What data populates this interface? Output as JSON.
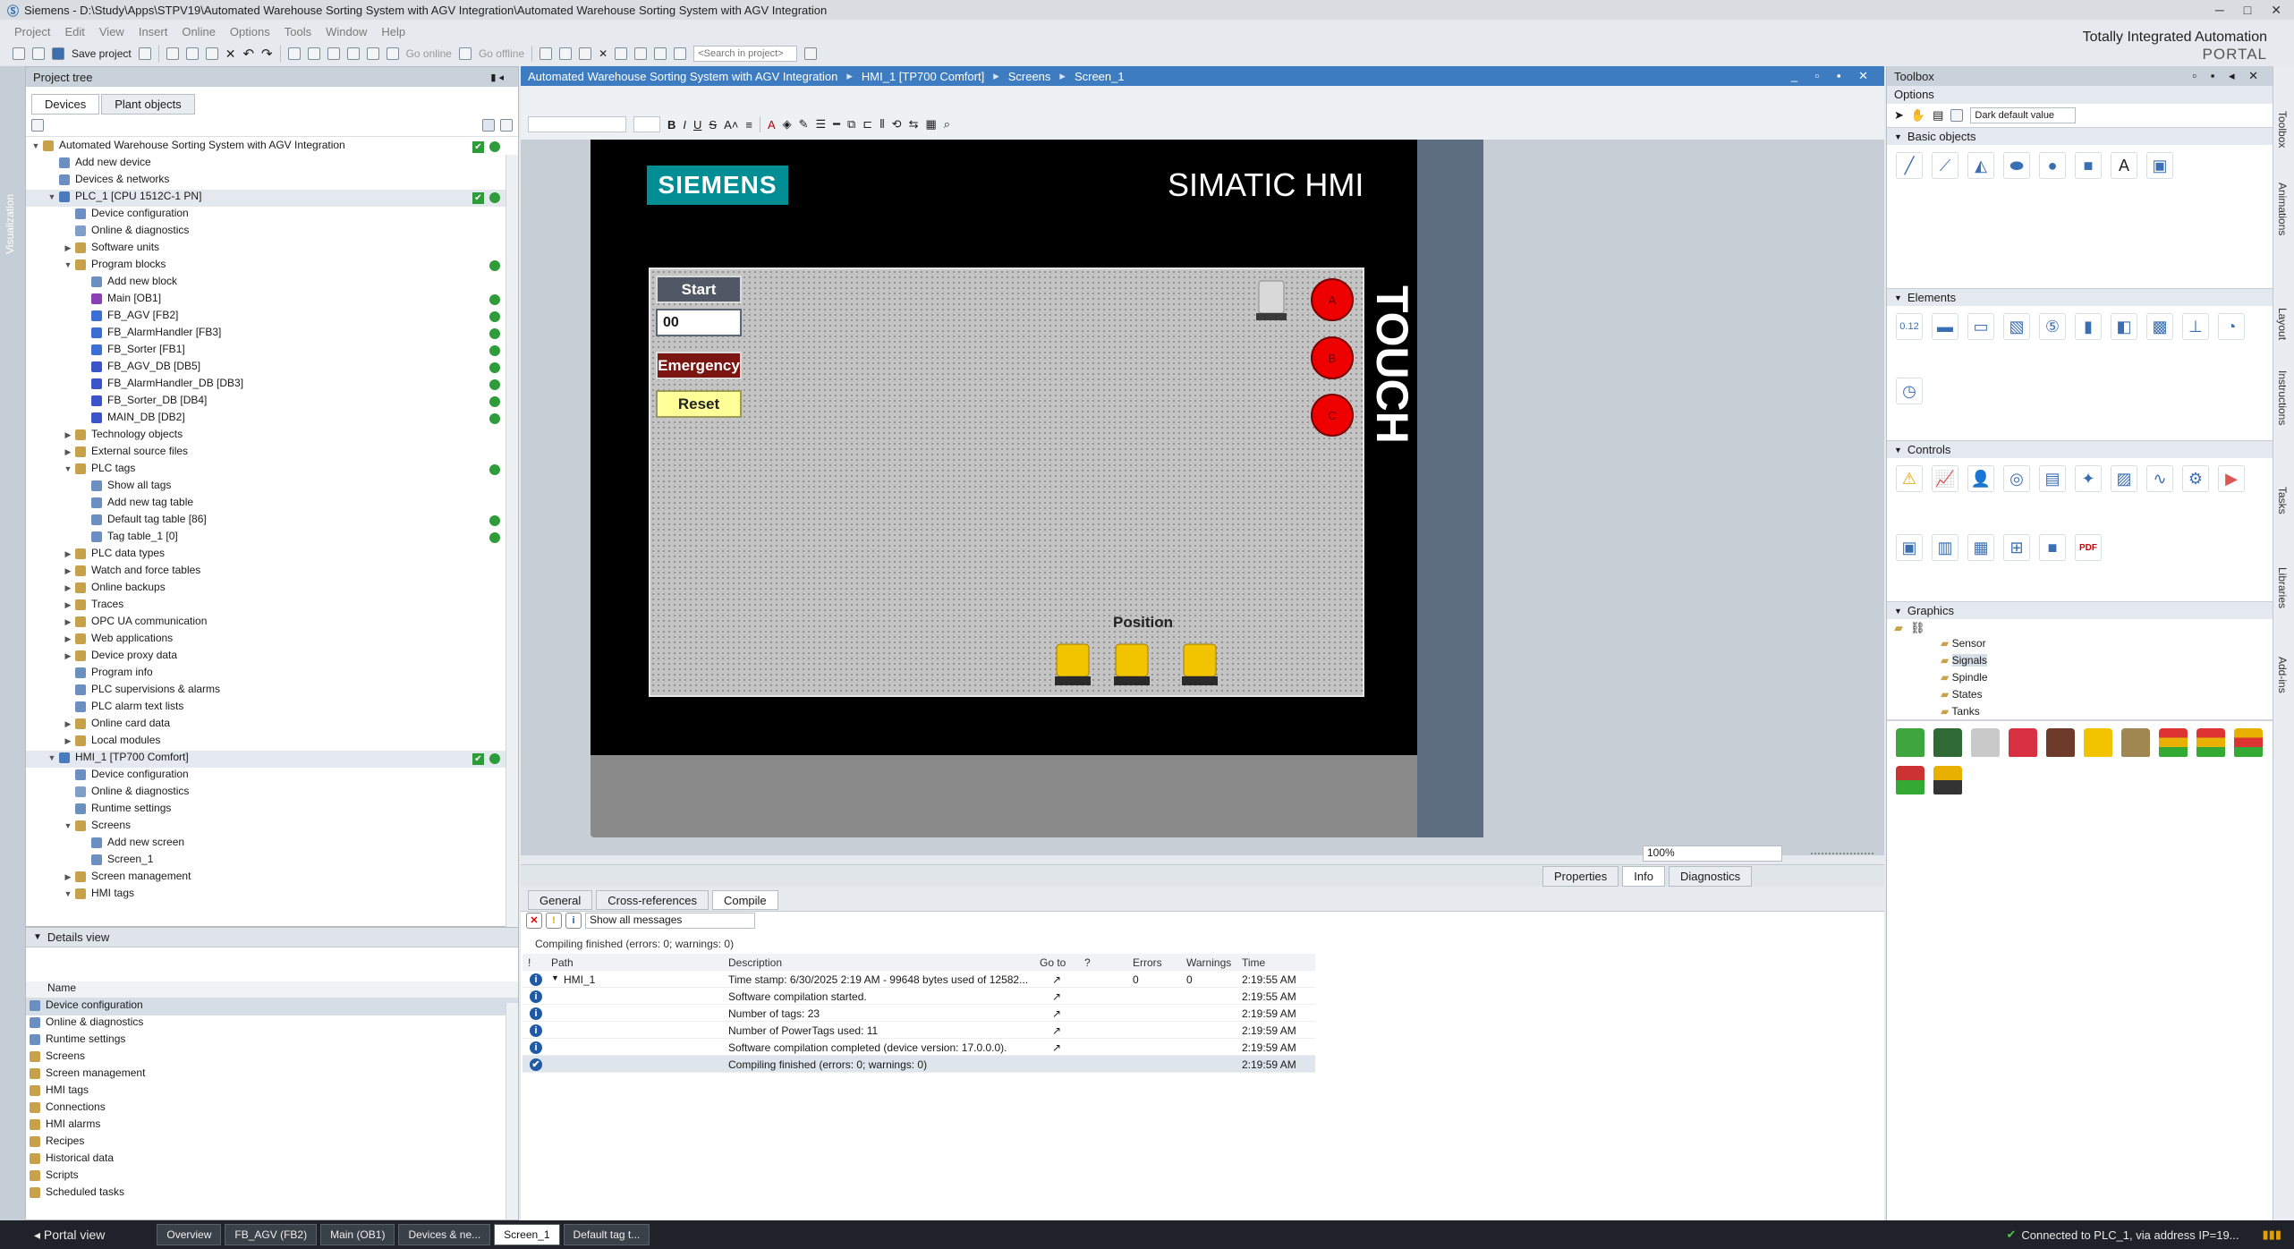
{
  "app": {
    "title": "Siemens  -  D:\\Study\\Apps\\STPV19\\Automated Warehouse Sorting System with AGV Integration\\Automated Warehouse Sorting System with AGV Integration",
    "brand_line1": "Totally Integrated Automation",
    "brand_line2": "PORTAL"
  },
  "menu": [
    "Project",
    "Edit",
    "View",
    "Insert",
    "Online",
    "Options",
    "Tools",
    "Window",
    "Help"
  ],
  "toolbar": {
    "save_label": "Save project",
    "go_online": "Go online",
    "go_offline": "Go offline",
    "search_placeholder": "<Search in project>"
  },
  "left_sidebar_tab": "Visualization",
  "project_tree": {
    "title": "Project tree",
    "tabs": [
      "Devices",
      "Plant objects"
    ],
    "items": [
      {
        "label": "Automated Warehouse Sorting System with AGV Integration",
        "level": 0,
        "exp": "▼",
        "status": "ok-check",
        "color": "#c8a24a"
      },
      {
        "label": "Add new device",
        "level": 1,
        "exp": "",
        "color": "#6c8fc2"
      },
      {
        "label": "Devices & networks",
        "level": 1,
        "exp": "",
        "color": "#6c8fc2"
      },
      {
        "label": "PLC_1 [CPU 1512C-1 PN]",
        "level": 1,
        "exp": "▼",
        "status": "ok-check",
        "color": "#4a7bbf",
        "selected": true
      },
      {
        "label": "Device configuration",
        "level": 2,
        "exp": "",
        "color": "#6c8fc2"
      },
      {
        "label": "Online & diagnostics",
        "level": 2,
        "exp": "",
        "color": "#7f9fc9"
      },
      {
        "label": "Software units",
        "level": 2,
        "exp": "▶",
        "color": "#c8a24a"
      },
      {
        "label": "Program blocks",
        "level": 2,
        "exp": "▼",
        "status": "ok",
        "color": "#c8a24a"
      },
      {
        "label": "Add new block",
        "level": 3,
        "exp": "",
        "color": "#6c8fc2"
      },
      {
        "label": "Main [OB1]",
        "level": 3,
        "exp": "",
        "status": "ok",
        "color": "#8a3fb5"
      },
      {
        "label": "FB_AGV [FB2]",
        "level": 3,
        "exp": "",
        "status": "ok",
        "color": "#3b6fd4"
      },
      {
        "label": "FB_AlarmHandler [FB3]",
        "level": 3,
        "exp": "",
        "status": "ok",
        "color": "#3b6fd4"
      },
      {
        "label": "FB_Sorter [FB1]",
        "level": 3,
        "exp": "",
        "status": "ok",
        "color": "#3b6fd4"
      },
      {
        "label": "FB_AGV_DB [DB5]",
        "level": 3,
        "exp": "",
        "status": "ok",
        "color": "#3b54c9"
      },
      {
        "label": "FB_AlarmHandler_DB [DB3]",
        "level": 3,
        "exp": "",
        "status": "ok",
        "color": "#3b54c9"
      },
      {
        "label": "FB_Sorter_DB [DB4]",
        "level": 3,
        "exp": "",
        "status": "ok",
        "color": "#3b54c9"
      },
      {
        "label": "MAIN_DB [DB2]",
        "level": 3,
        "exp": "",
        "status": "ok",
        "color": "#3b54c9"
      },
      {
        "label": "Technology objects",
        "level": 2,
        "exp": "▶",
        "color": "#c8a24a"
      },
      {
        "label": "External source files",
        "level": 2,
        "exp": "▶",
        "color": "#c8a24a"
      },
      {
        "label": "PLC tags",
        "level": 2,
        "exp": "▼",
        "status": "ok",
        "color": "#c8a24a"
      },
      {
        "label": "Show all tags",
        "level": 3,
        "exp": "",
        "color": "#6c8fc2"
      },
      {
        "label": "Add new tag table",
        "level": 3,
        "exp": "",
        "color": "#6c8fc2"
      },
      {
        "label": "Default tag table [86]",
        "level": 3,
        "exp": "",
        "status": "ok",
        "color": "#6c8fc2"
      },
      {
        "label": "Tag table_1 [0]",
        "level": 3,
        "exp": "",
        "status": "ok",
        "color": "#6c8fc2"
      },
      {
        "label": "PLC data types",
        "level": 2,
        "exp": "▶",
        "color": "#c8a24a"
      },
      {
        "label": "Watch and force tables",
        "level": 2,
        "exp": "▶",
        "color": "#c8a24a"
      },
      {
        "label": "Online backups",
        "level": 2,
        "exp": "▶",
        "color": "#c8a24a"
      },
      {
        "label": "Traces",
        "level": 2,
        "exp": "▶",
        "color": "#c8a24a"
      },
      {
        "label": "OPC UA communication",
        "level": 2,
        "exp": "▶",
        "color": "#c8a24a"
      },
      {
        "label": "Web applications",
        "level": 2,
        "exp": "▶",
        "color": "#c8a24a"
      },
      {
        "label": "Device proxy data",
        "level": 2,
        "exp": "▶",
        "color": "#c8a24a"
      },
      {
        "label": "Program info",
        "level": 2,
        "exp": "",
        "color": "#6c8fc2"
      },
      {
        "label": "PLC supervisions & alarms",
        "level": 2,
        "exp": "",
        "color": "#6c8fc2"
      },
      {
        "label": "PLC alarm text lists",
        "level": 2,
        "exp": "",
        "color": "#6c8fc2"
      },
      {
        "label": "Online card data",
        "level": 2,
        "exp": "▶",
        "color": "#c8a24a"
      },
      {
        "label": "Local modules",
        "level": 2,
        "exp": "▶",
        "color": "#c8a24a"
      },
      {
        "label": "HMI_1 [TP700 Comfort]",
        "level": 1,
        "exp": "▼",
        "status": "ok-check",
        "color": "#4a7bbf",
        "selected": true
      },
      {
        "label": "Device configuration",
        "level": 2,
        "exp": "",
        "color": "#6c8fc2"
      },
      {
        "label": "Online & diagnostics",
        "level": 2,
        "exp": "",
        "color": "#7f9fc9"
      },
      {
        "label": "Runtime settings",
        "level": 2,
        "exp": "",
        "color": "#6c8fc2"
      },
      {
        "label": "Screens",
        "level": 2,
        "exp": "▼",
        "color": "#c8a24a"
      },
      {
        "label": "Add new screen",
        "level": 3,
        "exp": "",
        "color": "#6c8fc2"
      },
      {
        "label": "Screen_1",
        "level": 3,
        "exp": "",
        "color": "#6c8fc2"
      },
      {
        "label": "Screen management",
        "level": 2,
        "exp": "▶",
        "color": "#c8a24a"
      },
      {
        "label": "HMI tags",
        "level": 2,
        "exp": "▼",
        "color": "#c8a24a"
      }
    ]
  },
  "details_view": {
    "title": "Details view",
    "column": "Name",
    "items": [
      "Device configuration",
      "Online & diagnostics",
      "Runtime settings",
      "Screens",
      "Screen management",
      "HMI tags",
      "Connections",
      "HMI alarms",
      "Recipes",
      "Historical data",
      "Scripts",
      "Scheduled tasks"
    ]
  },
  "breadcrumb": [
    "Automated Warehouse Sorting System with AGV Integration",
    "HMI_1 [TP700 Comfort]",
    "Screens",
    "Screen_1"
  ],
  "hmi": {
    "logo": "SIEMENS",
    "product": "SIMATIC HMI",
    "touch": "TOUCH",
    "start": "Start",
    "output_value": "00",
    "emergency": "Emergency",
    "reset": "Reset",
    "indicators": [
      "A",
      "B",
      "C"
    ],
    "position_label": "Position"
  },
  "zoom": "100%",
  "bottom_tabs": [
    "General",
    "Cross-references",
    "Compile"
  ],
  "inspector_tabs": [
    "Properties",
    "Info",
    "Diagnostics"
  ],
  "compile": {
    "filter": "Show all messages",
    "summary": "Compiling finished (errors: 0; warnings: 0)",
    "columns": [
      "!",
      "Path",
      "Description",
      "Go to",
      "?",
      "Errors",
      "Warnings",
      "Time"
    ],
    "rows": [
      {
        "path": "HMI_1",
        "description": "Time stamp: 6/30/2025 2:19 AM - 99648 bytes used of 12582...",
        "errors": "0",
        "warnings": "0",
        "time": "2:19:55 AM"
      },
      {
        "path": "",
        "description": "Software compilation started.",
        "errors": "",
        "warnings": "",
        "time": "2:19:55 AM"
      },
      {
        "path": "",
        "description": "Number of tags: 23",
        "errors": "",
        "warnings": "",
        "time": "2:19:59 AM"
      },
      {
        "path": "",
        "description": "Number of PowerTags used: 11",
        "errors": "",
        "warnings": "",
        "time": "2:19:59 AM"
      },
      {
        "path": "",
        "description": "Software compilation completed (device version: 17.0.0.0).",
        "errors": "",
        "warnings": "",
        "time": "2:19:59 AM"
      },
      {
        "path": "",
        "description": "Compiling finished (errors: 0; warnings: 0)",
        "errors": "",
        "warnings": "",
        "time": "2:19:59 AM"
      }
    ]
  },
  "toolbox": {
    "title": "Toolbox",
    "options": "Options",
    "style_select": "Dark default value",
    "sections": {
      "basic": "Basic objects",
      "elements": "Elements",
      "controls": "Controls",
      "graphics": "Graphics"
    },
    "graphics_tree": [
      "Sensor",
      "Signals",
      "Spindle",
      "States",
      "Tanks"
    ]
  },
  "right_tabs": [
    "Toolbox",
    "Animations",
    "Layout",
    "Instructions",
    "Tasks",
    "Libraries",
    "Add-ins"
  ],
  "statusbar": {
    "portal_view": "Portal view",
    "tabs": [
      "Overview",
      "FB_AGV (FB2)",
      "Main (OB1)",
      "Devices & ne...",
      "Screen_1",
      "Default tag t..."
    ],
    "connection": "Connected to PLC_1, via address IP=19..."
  }
}
